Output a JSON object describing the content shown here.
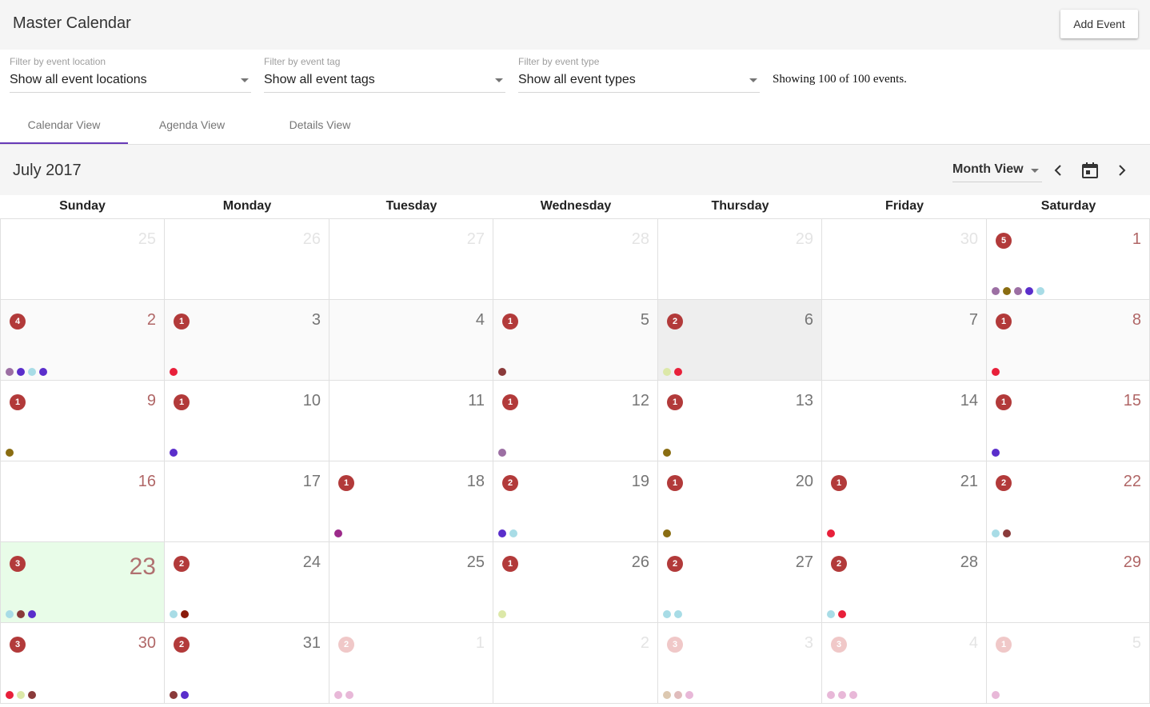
{
  "header": {
    "title": "Master Calendar",
    "add_event_label": "Add Event"
  },
  "filters": [
    {
      "label": "Filter by event location",
      "value": "Show all event locations"
    },
    {
      "label": "Filter by event tag",
      "value": "Show all event tags"
    },
    {
      "label": "Filter by event type",
      "value": "Show all event types"
    }
  ],
  "showing_text": "Showing 100 of 100 events.",
  "tabs": [
    {
      "label": "Calendar View",
      "active": true
    },
    {
      "label": "Agenda View",
      "active": false
    },
    {
      "label": "Details View",
      "active": false
    }
  ],
  "calendar": {
    "month_title": "July 2017",
    "view_mode": "Month View",
    "weekdays": [
      "Sunday",
      "Monday",
      "Tuesday",
      "Wednesday",
      "Thursday",
      "Friday",
      "Saturday"
    ],
    "days": [
      {
        "day": "25",
        "outside": true,
        "count": null,
        "dots": []
      },
      {
        "day": "26",
        "outside": true,
        "count": null,
        "dots": []
      },
      {
        "day": "27",
        "outside": true,
        "count": null,
        "dots": []
      },
      {
        "day": "28",
        "outside": true,
        "count": null,
        "dots": []
      },
      {
        "day": "29",
        "outside": true,
        "count": null,
        "dots": []
      },
      {
        "day": "30",
        "outside": true,
        "count": null,
        "dots": []
      },
      {
        "day": "1",
        "count": "5",
        "dots": [
          "#9c6fa3",
          "#8a6d12",
          "#9c6fa3",
          "#5a2ecb",
          "#a8dce6"
        ]
      },
      {
        "day": "2",
        "count": "4",
        "dots": [
          "#9c6fa3",
          "#5a2ecb",
          "#a8dce6",
          "#5a2ecb"
        ]
      },
      {
        "day": "3",
        "count": "1",
        "dots": [
          "#e8203a"
        ]
      },
      {
        "day": "4",
        "count": null,
        "dots": []
      },
      {
        "day": "5",
        "count": "1",
        "dots": [
          "#8a3a3a"
        ]
      },
      {
        "day": "6",
        "count": "2",
        "selected": true,
        "dots": [
          "#dce8a8",
          "#e8203a"
        ]
      },
      {
        "day": "7",
        "count": null,
        "dots": []
      },
      {
        "day": "8",
        "count": "1",
        "dots": [
          "#e8203a"
        ]
      },
      {
        "day": "9",
        "count": "1",
        "dots": [
          "#8a6d12"
        ]
      },
      {
        "day": "10",
        "count": "1",
        "dots": [
          "#5a2ecb"
        ]
      },
      {
        "day": "11",
        "count": null,
        "dots": []
      },
      {
        "day": "12",
        "count": "1",
        "dots": [
          "#9c6fa3"
        ]
      },
      {
        "day": "13",
        "count": "1",
        "dots": [
          "#8a6d12"
        ]
      },
      {
        "day": "14",
        "count": null,
        "dots": []
      },
      {
        "day": "15",
        "count": "1",
        "dots": [
          "#5a2ecb"
        ]
      },
      {
        "day": "16",
        "count": null,
        "dots": []
      },
      {
        "day": "17",
        "count": null,
        "dots": []
      },
      {
        "day": "18",
        "count": "1",
        "dots": [
          "#9c2a8a"
        ]
      },
      {
        "day": "19",
        "count": "2",
        "dots": [
          "#5a2ecb",
          "#a8dce6"
        ]
      },
      {
        "day": "20",
        "count": "1",
        "dots": [
          "#8a6d12"
        ]
      },
      {
        "day": "21",
        "count": "1",
        "dots": [
          "#e8203a"
        ]
      },
      {
        "day": "22",
        "count": "2",
        "dots": [
          "#a8dce6",
          "#8a3a3a"
        ]
      },
      {
        "day": "23",
        "count": "3",
        "today": true,
        "dots": [
          "#a8dce6",
          "#8a3a3a",
          "#5a2ecb"
        ]
      },
      {
        "day": "24",
        "count": "2",
        "dots": [
          "#a8dce6",
          "#8a1a0a"
        ]
      },
      {
        "day": "25",
        "count": null,
        "dots": []
      },
      {
        "day": "26",
        "count": "1",
        "dots": [
          "#dce8a8"
        ]
      },
      {
        "day": "27",
        "count": "2",
        "dots": [
          "#a8dce6",
          "#a8dce6"
        ]
      },
      {
        "day": "28",
        "count": "2",
        "dots": [
          "#a8dce6",
          "#e8203a"
        ]
      },
      {
        "day": "29",
        "count": null,
        "dots": []
      },
      {
        "day": "30",
        "count": "3",
        "dots": [
          "#e8203a",
          "#dce8a8",
          "#8a3a3a"
        ]
      },
      {
        "day": "31",
        "count": "2",
        "dots": [
          "#8a3a3a",
          "#5a2ecb"
        ]
      },
      {
        "day": "1",
        "outside": true,
        "count": "2",
        "dots": [
          "#e8b8d8",
          "#e8b8d8"
        ]
      },
      {
        "day": "2",
        "outside": true,
        "count": null,
        "dots": []
      },
      {
        "day": "3",
        "outside": true,
        "count": "3",
        "dots": [
          "#dcc8b0",
          "#e0bcbc",
          "#e8b8d8"
        ]
      },
      {
        "day": "4",
        "outside": true,
        "count": "3",
        "dots": [
          "#e8b8d8",
          "#e8b8d8",
          "#e8b8d8"
        ]
      },
      {
        "day": "5",
        "outside": true,
        "count": "1",
        "dots": [
          "#e8b8d8"
        ]
      }
    ]
  }
}
